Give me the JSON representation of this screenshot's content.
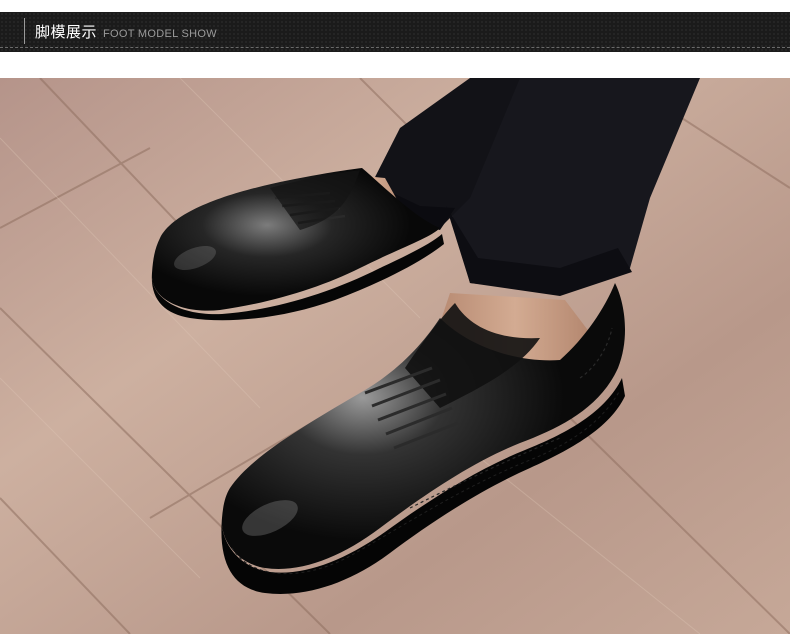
{
  "header": {
    "title": "脚模展示",
    "subtitle": "FOOT MODEL SHOW"
  },
  "photo": {
    "subject": "black leather derby shoes on model",
    "colors": {
      "floor_light": "#c9ab99",
      "floor_dark": "#8e6e5e",
      "shoe": "#0c0c0c",
      "pants": "#16161c",
      "skin": "#c49a82"
    }
  }
}
